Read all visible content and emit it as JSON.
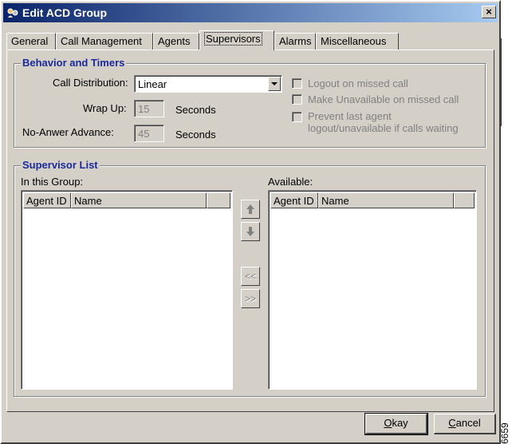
{
  "window": {
    "title": "Edit ACD Group",
    "close_label": "×"
  },
  "tabs": [
    {
      "label": "General"
    },
    {
      "label": "Call Management"
    },
    {
      "label": "Agents"
    },
    {
      "label": "Supervisors"
    },
    {
      "label": "Alarms"
    },
    {
      "label": "Miscellaneous"
    }
  ],
  "active_tab": "Supervisors",
  "behavior": {
    "title": "Behavior and Timers",
    "call_distribution_label": "Call Distribution:",
    "call_distribution_value": "Linear",
    "wrap_up_label": "Wrap Up:",
    "wrap_up_value": "15",
    "wrap_up_unit": "Seconds",
    "no_answer_label": "No-Anwer Advance:",
    "no_answer_value": "45",
    "no_answer_unit": "Seconds",
    "logout_missed": "Logout on missed call",
    "unavailable_missed": "Make Unavailable on missed call",
    "prevent_line1": "Prevent last agent",
    "prevent_line2": "logout/unavailable if calls waiting"
  },
  "supervisor_list": {
    "title": "Supervisor List",
    "in_group_label": "In this Group:",
    "available_label": "Available:",
    "columns": [
      "Agent ID",
      "Name"
    ],
    "move_up_icon": "up-arrow-icon",
    "move_down_icon": "down-arrow-icon",
    "add_label": "<<",
    "remove_label": ">>"
  },
  "footer": {
    "okay_label": "Okay",
    "cancel_label": "Cancel"
  },
  "side_number": "6659",
  "colors": {
    "title_bar": "#0a246a",
    "group_title": "#1a2a9a",
    "face": "#d4d0c8"
  }
}
